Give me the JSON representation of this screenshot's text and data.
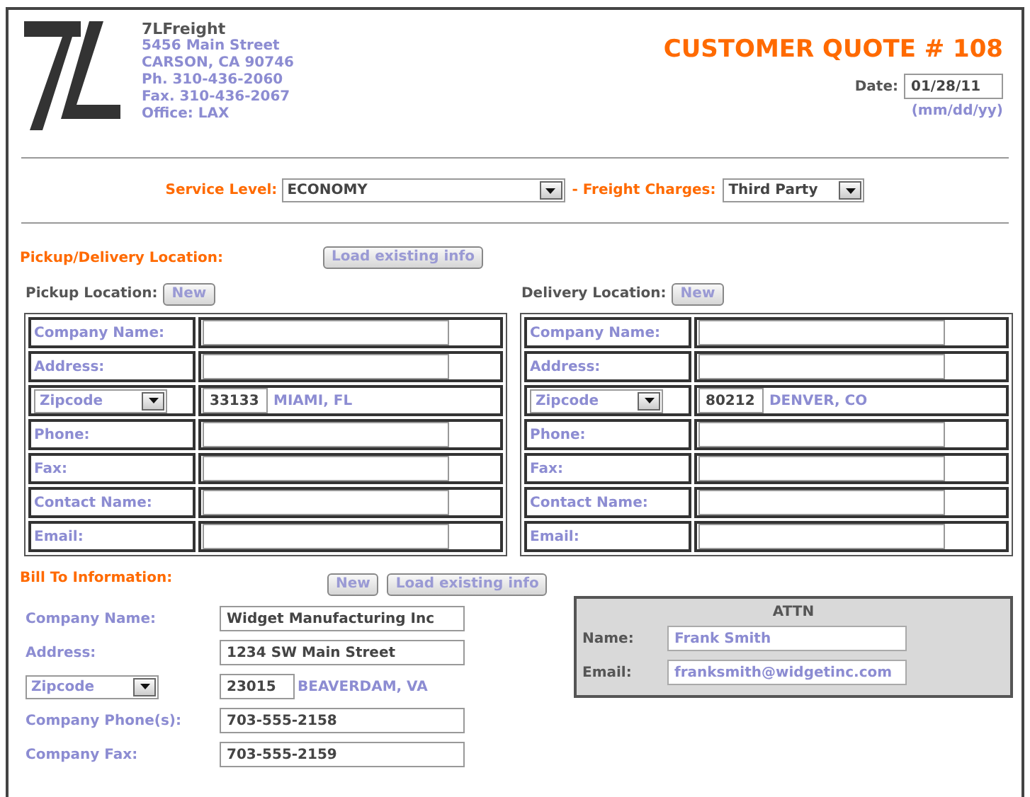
{
  "company": {
    "name": "7LFreight",
    "lines": [
      "5456 Main Street",
      "CARSON, CA 90746",
      "Ph. 310-436-2060",
      "Fax. 310-436-2067",
      "Office: LAX"
    ]
  },
  "quote_title": "CUSTOMER QUOTE # 108",
  "date": {
    "label": "Date:",
    "value": "01/28/11",
    "hint": "(mm/dd/yy)"
  },
  "service": {
    "label": "Service Level:",
    "value": "ECONOMY"
  },
  "freight": {
    "label": "- Freight Charges:",
    "value": "Third Party"
  },
  "pickup_delivery": {
    "heading": "Pickup/Delivery Location:",
    "load_button": "Load existing info"
  },
  "locations": [
    {
      "heading": "Pickup Location:",
      "new_button": "New",
      "rows": [
        {
          "kind": "field",
          "label": "Company Name:"
        },
        {
          "kind": "field",
          "label": "Address:"
        },
        {
          "kind": "zip",
          "select": "Zipcode",
          "zip": "33133",
          "city": "MIAMI, FL"
        },
        {
          "kind": "field",
          "label": "Phone:"
        },
        {
          "kind": "field",
          "label": "Fax:"
        },
        {
          "kind": "field",
          "label": "Contact Name:"
        },
        {
          "kind": "field",
          "label": "Email:"
        }
      ]
    },
    {
      "heading": "Delivery Location:",
      "new_button": "New",
      "rows": [
        {
          "kind": "field",
          "label": "Company Name:"
        },
        {
          "kind": "field",
          "label": "Address:"
        },
        {
          "kind": "zip",
          "select": "Zipcode",
          "zip": "80212",
          "city": "DENVER, CO"
        },
        {
          "kind": "field",
          "label": "Phone:"
        },
        {
          "kind": "field",
          "label": "Fax:"
        },
        {
          "kind": "field",
          "label": "Contact Name:"
        },
        {
          "kind": "field",
          "label": "Email:"
        }
      ]
    }
  ],
  "bill_to": {
    "heading": "Bill To Information:",
    "buttons": [
      "New",
      "Load existing info"
    ],
    "rows": [
      {
        "kind": "field",
        "label": "Company Name:",
        "value": "Widget Manufacturing Inc"
      },
      {
        "kind": "field",
        "label": "Address:",
        "value": "1234 SW Main Street"
      },
      {
        "kind": "zip",
        "select": "Zipcode",
        "zip": "23015",
        "city": "BEAVERDAM, VA"
      },
      {
        "kind": "field",
        "label": "Company Phone(s):",
        "value": "703-555-2158"
      },
      {
        "kind": "field",
        "label": "Company Fax:",
        "value": "703-555-2159"
      }
    ],
    "attn": {
      "title": "ATTN",
      "rows": [
        {
          "label": "Name:",
          "value": "Frank Smith"
        },
        {
          "label": "Email:",
          "value": "franksmith@widgetinc.com"
        }
      ]
    }
  }
}
